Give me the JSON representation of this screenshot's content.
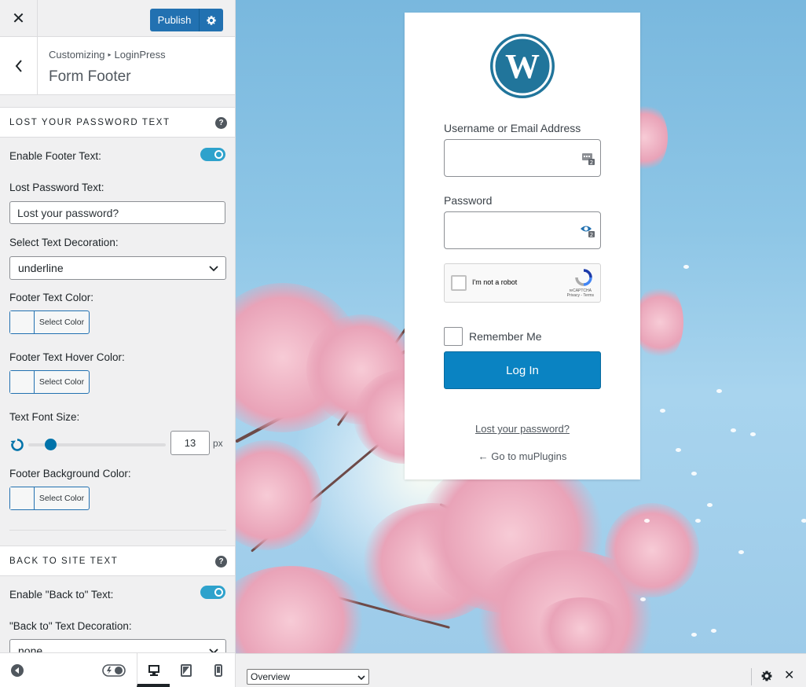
{
  "topbar": {
    "close_label": "✕",
    "publish_label": "Publish"
  },
  "section": {
    "breadcrumb_root": "Customizing",
    "breadcrumb_sep": "▸",
    "breadcrumb_leaf": "LoginPress",
    "title": "Form Footer"
  },
  "lost_password_group": {
    "heading": "LOST YOUR PASSWORD TEXT",
    "enable_footer_label": "Enable Footer Text:",
    "enable_footer_on": true,
    "lost_text_label": "Lost Password Text:",
    "lost_text_value": "Lost your password?",
    "decoration_label": "Select Text Decoration:",
    "decoration_value": "underline",
    "footer_color_label": "Footer Text Color:",
    "footer_hover_label": "Footer Text Hover Color:",
    "select_color": "Select Color",
    "font_size_label": "Text Font Size:",
    "font_size_value": "13",
    "font_size_unit": "px",
    "font_size_fraction": 0.16,
    "bg_color_label": "Footer Background Color:"
  },
  "back_group": {
    "heading": "BACK TO SITE TEXT",
    "enable_back_label": "Enable \"Back to\" Text:",
    "enable_back_on": true,
    "back_decoration_label": "\"Back to\" Text Decoration:",
    "back_decoration_value": "none"
  },
  "login_form": {
    "username_label": "Username or Email Address",
    "password_label": "Password",
    "captcha_text": "I'm not a robot",
    "captcha_brand": "reCAPTCHA",
    "captcha_links": "Privacy - Terms",
    "remember_label": "Remember Me",
    "login_button": "Log In",
    "lost_link": "Lost your password?",
    "back_link": "← Go to muPlugins"
  },
  "devbar": {
    "overview_value": "Overview",
    "close_label": "✕"
  },
  "colors": {
    "accent": "#2271b1",
    "toggle": "#2ea2cc",
    "login_button": "#0a83c2",
    "wp_logo": "#21759b"
  },
  "icons": [
    "close-icon",
    "gear-icon",
    "chevron-left-icon",
    "help-icon",
    "chevron-down-icon",
    "reset-icon",
    "wordpress-logo",
    "password-manager-icon",
    "eye-icon",
    "recaptcha-icon",
    "collapse-icon",
    "toggle-icon",
    "desktop-icon",
    "tablet-icon",
    "mobile-icon"
  ]
}
